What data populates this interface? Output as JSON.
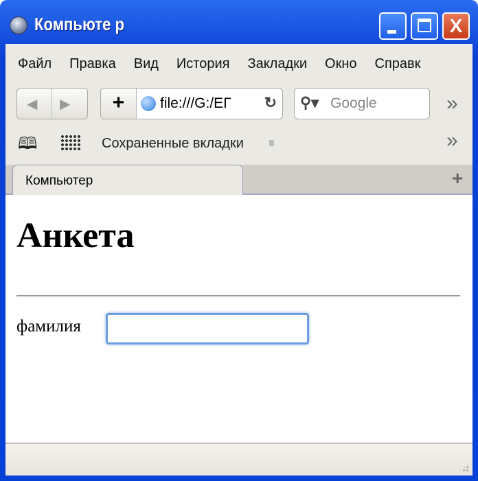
{
  "window": {
    "title": "Компьюте р",
    "minimize": "▁",
    "maximize": "□",
    "close": "X"
  },
  "menu": [
    "Файл",
    "Правка",
    "Вид",
    "История",
    "Закладки",
    "Окно",
    "Справк"
  ],
  "nav": {
    "back": "◀",
    "forward": "▶",
    "add": "+",
    "url": "file:///G:/EГ",
    "reload": "↻",
    "search_placeholder": "Google",
    "overflow": "»"
  },
  "bookmarks": {
    "saved_tabs": "Сохраненные вкладки",
    "overflow": "»"
  },
  "tabs": {
    "active": "Компьютер",
    "new_tab": "+"
  },
  "page": {
    "heading": "Анкета",
    "field_label": "фамилия",
    "field_value": ""
  }
}
